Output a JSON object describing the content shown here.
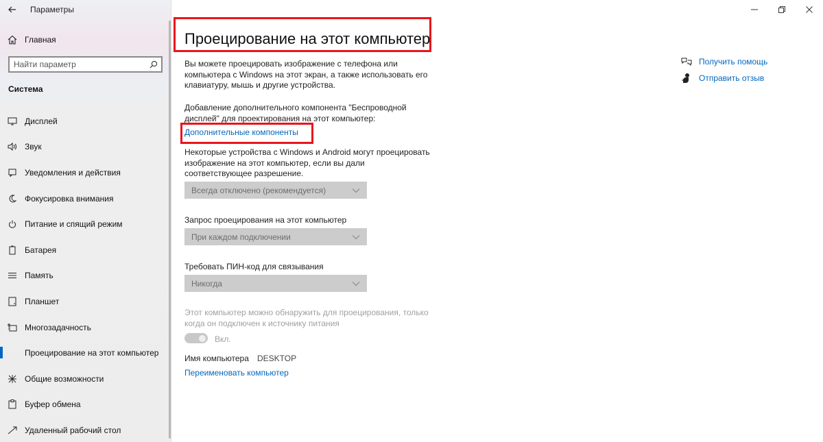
{
  "window": {
    "app_title": "Параметры"
  },
  "sidebar": {
    "home_label": "Главная",
    "search_placeholder": "Найти параметр",
    "section_title": "Система",
    "items": [
      {
        "label": "Дисплей",
        "icon": "display-icon"
      },
      {
        "label": "Звук",
        "icon": "sound-icon"
      },
      {
        "label": "Уведомления и действия",
        "icon": "notifications-icon"
      },
      {
        "label": "Фокусировка внимания",
        "icon": "focus-assist-icon"
      },
      {
        "label": "Питание и спящий режим",
        "icon": "power-icon"
      },
      {
        "label": "Батарея",
        "icon": "battery-icon"
      },
      {
        "label": "Память",
        "icon": "storage-icon"
      },
      {
        "label": "Планшет",
        "icon": "tablet-icon"
      },
      {
        "label": "Многозадачность",
        "icon": "multitasking-icon"
      },
      {
        "label": "Проецирование на этот компьютер",
        "icon": "projecting-icon",
        "active": true
      },
      {
        "label": "Общие возможности",
        "icon": "shared-experiences-icon"
      },
      {
        "label": "Буфер обмена",
        "icon": "clipboard-icon"
      },
      {
        "label": "Удаленный рабочий стол",
        "icon": "remote-desktop-icon"
      }
    ]
  },
  "main": {
    "page_title": "Проецирование на этот компьютер",
    "intro": "Вы можете проецировать изображение с телефона или компьютера с Windows на этот экран, а также использовать его клавиатуру, мышь и другие устройства.",
    "addon_text": "Добавление дополнительного компонента \"Беспроводной дисплей\" для проектирования на этот компьютер:",
    "addon_link": "Дополнительные компоненты",
    "devices_text": "Некоторые устройства с Windows и Android могут проецировать изображение на этот компьютер, если вы дали соответствующее разрешение.",
    "devices_select": "Всегда отключено (рекомендуется)",
    "request_label": "Запрос проецирования на этот компьютер",
    "request_select": "При каждом подключении",
    "pin_label": "Требовать ПИН-код для связывания",
    "pin_select": "Никогда",
    "power_text": "Этот компьютер можно обнаружить для проецирования, только когда он подключен к источнику питания",
    "toggle_label": "Вкл.",
    "pc_name_label": "Имя компьютера",
    "pc_name_value": "DESKTOP",
    "rename_link": "Переименовать компьютер"
  },
  "help": {
    "get_help": "Получить помощь",
    "feedback": "Отправить отзыв"
  },
  "colors": {
    "accent": "#0067c0",
    "highlight_border": "#e8141c"
  }
}
